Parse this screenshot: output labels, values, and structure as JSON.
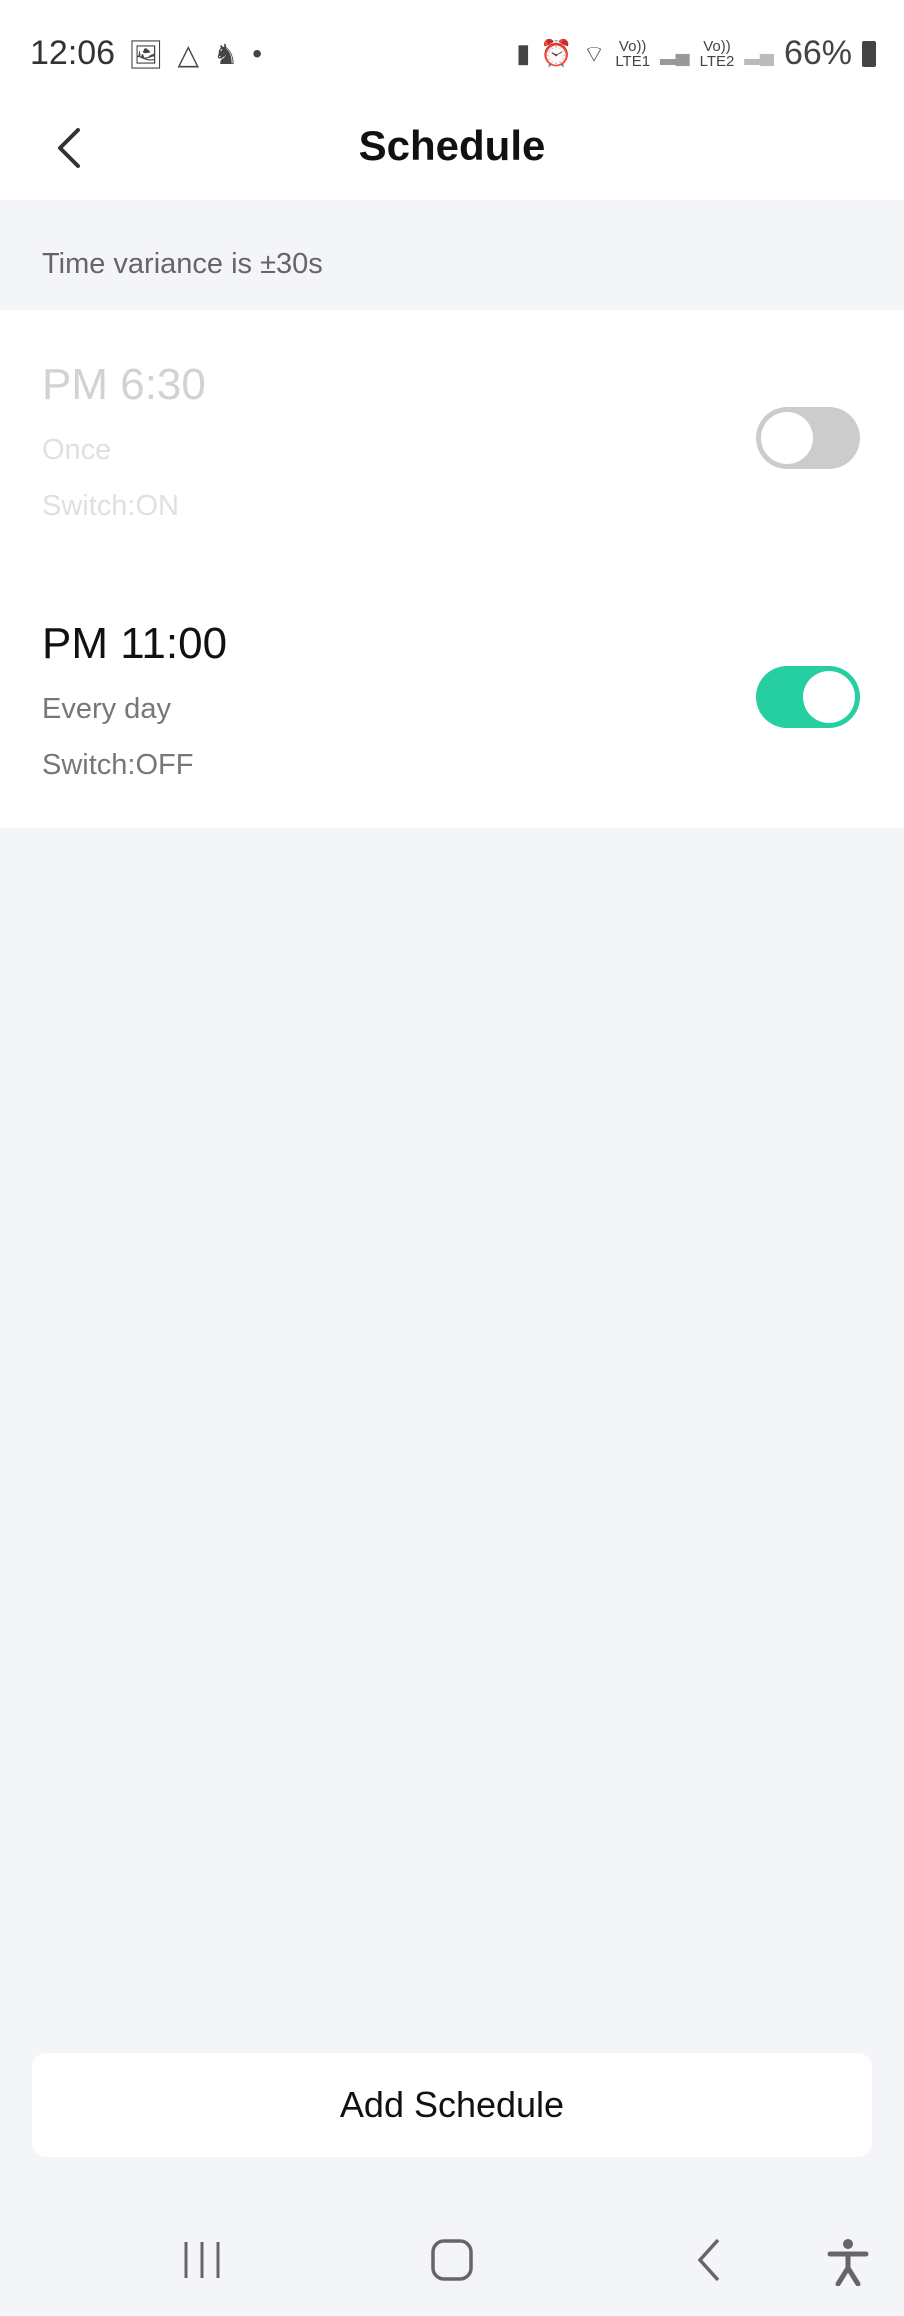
{
  "status_bar": {
    "time": "12:06",
    "battery": "66%",
    "net1": "LTE1",
    "net2": "LTE2",
    "volte": "Vo))",
    "icons": [
      "gallery-icon",
      "drive-icon",
      "app-icon",
      "dot-icon",
      "battery-saver-icon",
      "alarm-icon",
      "wifi-icon",
      "signal-icon",
      "battery-icon"
    ]
  },
  "header": {
    "title": "Schedule"
  },
  "note": "Time variance is ±30s",
  "schedules": [
    {
      "time": "PM 6:30",
      "repeat": "Once",
      "action": "Switch:ON",
      "enabled": false
    },
    {
      "time": "PM 11:00",
      "repeat": "Every day",
      "action": "Switch:OFF",
      "enabled": true
    }
  ],
  "add_button": "Add Schedule",
  "colors": {
    "accent": "#25cfa0",
    "toggle_off": "#cccccc",
    "background": "#f4f5f9"
  }
}
